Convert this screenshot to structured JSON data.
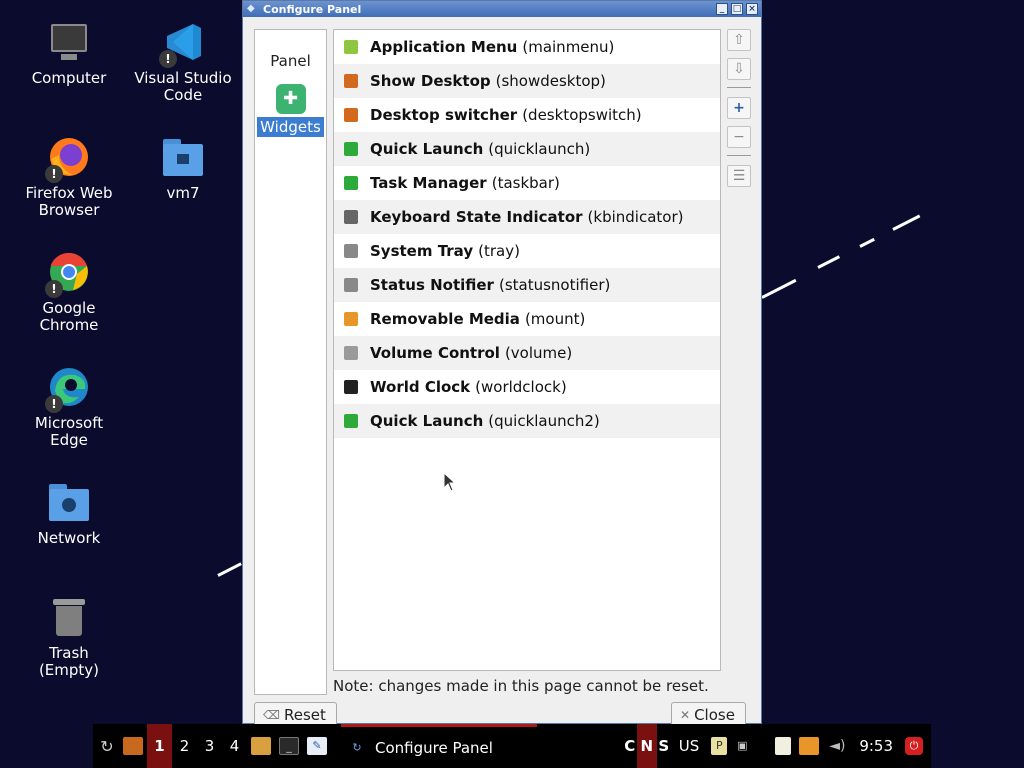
{
  "desktop": {
    "icons": [
      {
        "label": "Computer",
        "icon": "monitor-icon"
      },
      {
        "label": "Visual Studio Code",
        "icon": "vscode-icon"
      },
      {
        "label": "Firefox Web Browser",
        "icon": "firefox-icon"
      },
      {
        "label": "vm7",
        "icon": "folder-home-icon"
      },
      {
        "label": "Google Chrome",
        "icon": "chrome-icon"
      },
      {
        "label": "Microsoft Edge",
        "icon": "edge-icon"
      },
      {
        "label": "Network",
        "icon": "network-folder-icon"
      },
      {
        "label": "Trash\n(Empty)",
        "icon": "trash-icon"
      }
    ]
  },
  "window": {
    "title": "Configure Panel",
    "sidebar": {
      "panel_label": "Panel",
      "widgets_label": "Widgets"
    },
    "widgets": [
      {
        "name": "Application Menu",
        "id": "(mainmenu)",
        "icon": "app-menu-icon",
        "color": "#8dc63f"
      },
      {
        "name": "Show Desktop",
        "id": "(showdesktop)",
        "icon": "show-desktop-icon",
        "color": "#d2691e"
      },
      {
        "name": "Desktop switcher",
        "id": "(desktopswitch)",
        "icon": "desktop-switcher-icon",
        "color": "#d2691e"
      },
      {
        "name": "Quick Launch",
        "id": "(quicklaunch)",
        "icon": "quick-launch-icon",
        "color": "#2eaa3a"
      },
      {
        "name": "Task Manager",
        "id": "(taskbar)",
        "icon": "task-manager-icon",
        "color": "#2eaa3a"
      },
      {
        "name": "Keyboard State Indicator",
        "id": "(kbindicator)",
        "icon": "keyboard-icon",
        "color": "#666666"
      },
      {
        "name": "System Tray",
        "id": "(tray)",
        "icon": "system-tray-icon",
        "color": "#888888"
      },
      {
        "name": "Status Notifier",
        "id": "(statusnotifier)",
        "icon": "status-notifier-icon",
        "color": "#888888"
      },
      {
        "name": "Removable Media",
        "id": "(mount)",
        "icon": "removable-media-icon",
        "color": "#e8962a"
      },
      {
        "name": "Volume Control",
        "id": "(volume)",
        "icon": "volume-icon",
        "color": "#9a9a9a"
      },
      {
        "name": "World Clock",
        "id": "(worldclock)",
        "icon": "clock-icon",
        "color": "#222222"
      },
      {
        "name": "Quick Launch",
        "id": "(quicklaunch2)",
        "icon": "quick-launch-icon",
        "color": "#2eaa3a"
      }
    ],
    "note": "Note: changes made in this page cannot be reset.",
    "reset_label": "Reset",
    "close_label": "Close"
  },
  "taskbar": {
    "desktops": [
      "1",
      "2",
      "3",
      "4"
    ],
    "active_desktop": "1",
    "task_label": "Configure Panel",
    "kbd_indicators": [
      "C",
      "N",
      "S"
    ],
    "layout": "US",
    "clock": "9:53",
    "colors": {
      "active": "#7a1010",
      "accent": "#b01818"
    }
  }
}
